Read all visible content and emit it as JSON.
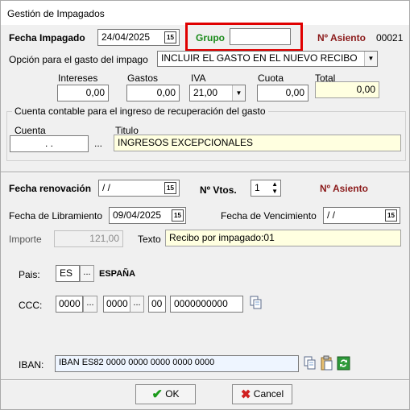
{
  "window": {
    "title": "Gestión de Impagados"
  },
  "header": {
    "fecha_impagado_label": "Fecha Impagado",
    "fecha_impagado_value": "24/04/2025",
    "grupo_label": "Grupo",
    "grupo_value": "",
    "n_asiento_label": "Nº Asiento",
    "n_asiento_value": "00021"
  },
  "gasto": {
    "opcion_label": "Opción para el gasto del impago",
    "opcion_value": "INCLUIR EL GASTO EN EL NUEVO RECIBO",
    "intereses_label": "Intereses",
    "intereses_value": "0,00",
    "gastos_label": "Gastos",
    "gastos_value": "0,00",
    "iva_label": "IVA",
    "iva_value": "21,00",
    "cuota_label": "Cuota",
    "cuota_value": "0,00",
    "total_label": "Total",
    "total_value": "0,00"
  },
  "cuenta_group": {
    "title": "Cuenta contable para el ingreso de recuperación del gasto",
    "cuenta_label": "Cuenta",
    "cuenta_value": ". .",
    "ellipsis": "...",
    "titulo_label": "Titulo",
    "titulo_value": "INGRESOS EXCEPCIONALES"
  },
  "renovacion": {
    "fecha_renovacion_label": "Fecha renovación",
    "fecha_renovacion_value": "/ /",
    "n_vtos_label": "Nº Vtos.",
    "n_vtos_value": "1",
    "n_asiento_label": "Nº Asiento",
    "fecha_libramiento_label": "Fecha de Libramiento",
    "fecha_libramiento_value": "09/04/2025",
    "fecha_vencimiento_label": "Fecha de Vencimiento",
    "fecha_vencimiento_value": "/ /",
    "importe_label": "Importe",
    "importe_value": "121,00",
    "texto_label": "Texto",
    "texto_value": "Recibo por impagado:01"
  },
  "banco": {
    "pais_label": "Pais:",
    "pais_value": "ES",
    "pais_name": "ESPAÑA",
    "ccc_label": "CCC:",
    "ccc_entidad": "0000",
    "ccc_oficina": "0000",
    "ccc_dc": "00",
    "ccc_cuenta": "0000000000",
    "iban_label": "IBAN:",
    "iban_value": "IBAN ES82 0000 0000 0000 0000 0000",
    "ellipsis": "..."
  },
  "footer": {
    "ok_label": "OK",
    "cancel_label": "Cancel"
  },
  "colors": {
    "highlight": "#e00000",
    "asiento": "#8b1a1a",
    "grupo": "#1a8a1a",
    "yellow_field": "#ffffe0"
  },
  "icons": [
    "calendar-icon",
    "dropdown-arrow-icon",
    "spin-icon",
    "copy-icon",
    "paste-icon",
    "refresh-icon",
    "check-icon",
    "cross-icon"
  ]
}
